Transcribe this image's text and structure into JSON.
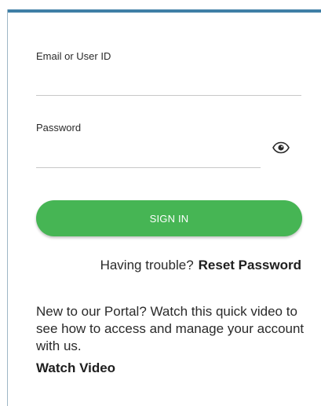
{
  "form": {
    "email_label": "Email or User ID",
    "email_value": "",
    "password_label": "Password",
    "password_value": "",
    "signin_label": "SIGN IN"
  },
  "help": {
    "trouble_text": "Having trouble?",
    "reset_label": "Reset Password"
  },
  "portal": {
    "intro_text": "New to our Portal? Watch this quick video to see how to access and manage your account with us.",
    "watch_label": "Watch Video"
  },
  "colors": {
    "accent_border": "#3f7fa6",
    "signin_button": "#46b554"
  },
  "icons": {
    "password_toggle": "eye-icon"
  }
}
